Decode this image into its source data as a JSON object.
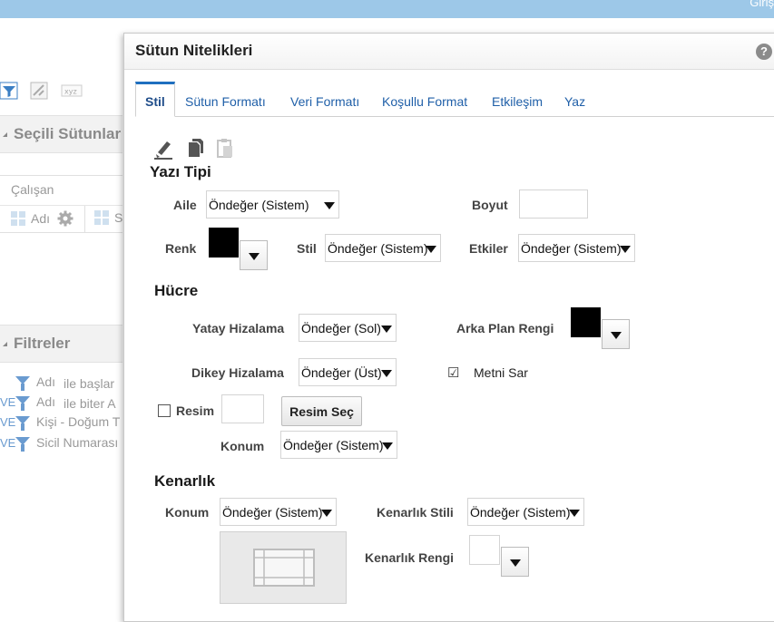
{
  "topbar": {
    "signin": "Giriş"
  },
  "background": {
    "selected_columns_title": "Seçili Sütunlar",
    "subject_area": "Çalışan",
    "columns": [
      {
        "label": "Adı"
      },
      {
        "label": "S"
      }
    ],
    "filters_title": "Filtreler",
    "filters": [
      {
        "prefix": "",
        "name": "Adı",
        "condition": "ile başlar"
      },
      {
        "prefix": "VE",
        "name": "Adı",
        "condition": "ile biter A"
      },
      {
        "prefix": "VE",
        "name": "Kişi - Doğum T",
        "condition": ""
      },
      {
        "prefix": "VE",
        "name": "Sicil Numarası",
        "condition": ""
      }
    ]
  },
  "dialog": {
    "title": "Sütun Nitelikleri",
    "help": "?",
    "tabs": [
      "Stil",
      "Sütun Formatı",
      "Veri Formatı",
      "Koşullu Format",
      "Etkileşim",
      "Yaz"
    ],
    "active_tab": "Stil",
    "font": {
      "heading": "Yazı Tipi",
      "family_label": "Aile",
      "family_value": "Öndeğer (Sistem)",
      "size_label": "Boyut",
      "size_value": "",
      "color_label": "Renk",
      "color_value": "#000000",
      "style_label": "Stil",
      "style_value": "Öndeğer (Sistem)",
      "effects_label": "Etkiler",
      "effects_value": "Öndeğer (Sistem)"
    },
    "cell": {
      "heading": "Hücre",
      "halign_label": "Yatay Hizalama",
      "halign_value": "Öndeğer (Sol)",
      "bg_color_label": "Arka Plan Rengi",
      "bg_color_value": "#000000",
      "valign_label": "Dikey Hizalama",
      "valign_value": "Öndeğer (Üst)",
      "wrap_label": "Metni Sar",
      "wrap_checked": true,
      "image_label": "Resim",
      "image_checked": false,
      "choose_image_button": "Resim Seç",
      "position_label": "Konum",
      "position_value": "Öndeğer (Sistem)"
    },
    "border": {
      "heading": "Kenarlık",
      "position_label": "Konum",
      "position_value": "Öndeğer (Sistem)",
      "style_label": "Kenarlık Stili",
      "style_value": "Öndeğer (Sistem)",
      "color_label": "Kenarlık Rengi",
      "color_value": "#ffffff"
    }
  }
}
